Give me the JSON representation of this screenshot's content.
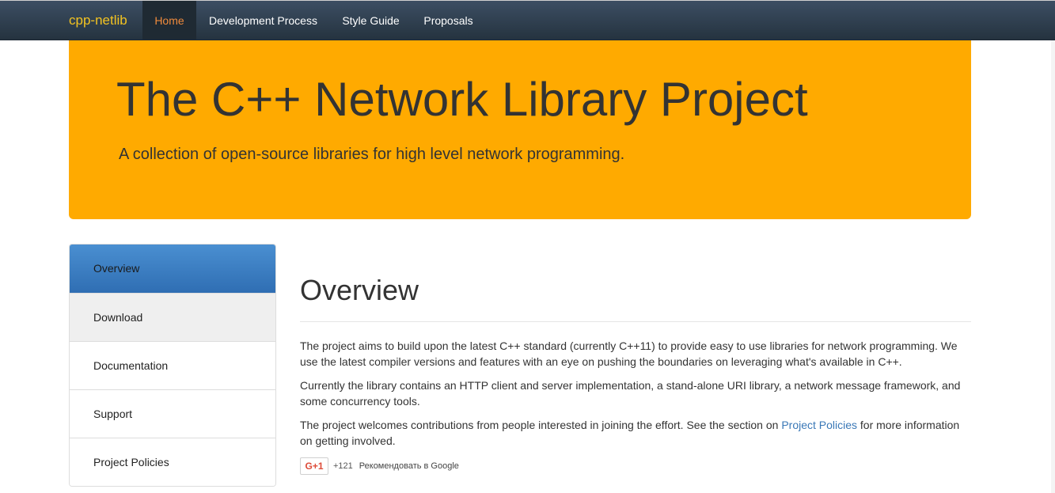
{
  "navbar": {
    "brand": "cpp-netlib",
    "items": [
      {
        "label": "Home",
        "active": true
      },
      {
        "label": "Development Process",
        "active": false
      },
      {
        "label": "Style Guide",
        "active": false
      },
      {
        "label": "Proposals",
        "active": false
      }
    ]
  },
  "jumbotron": {
    "title": "The C++ Network Library Project",
    "subtitle": "A collection of open-source libraries for high level network programming."
  },
  "sidebar": {
    "items": [
      {
        "label": "Overview",
        "active": true
      },
      {
        "label": "Download",
        "active": false
      },
      {
        "label": "Documentation",
        "active": false
      },
      {
        "label": "Support",
        "active": false
      },
      {
        "label": "Project Policies",
        "active": false
      }
    ]
  },
  "main": {
    "heading": "Overview",
    "paragraphs": [
      "The project aims to build upon the latest C++ standard (currently C++11) to provide easy to use libraries for network programming. We use the latest compiler versions and features with an eye on pushing the boundaries on leveraging what's available in C++.",
      "Currently the library contains an HTTP client and server implementation, a stand-alone URI library, a network message framework, and some concurrency tools."
    ],
    "p3_before": "The project welcomes contributions from people interested in joining the effort. See the section on ",
    "p3_link": "Project Policies",
    "p3_after": " for more information on getting involved."
  },
  "gplus": {
    "button_label": "G+1",
    "count": "+121",
    "label": "Рекомендовать в Google"
  },
  "colors": {
    "accent": "#ffaa00",
    "brand": "#f3c321",
    "active_nav": "#f08b3c",
    "sidebar_active": "#337ab7",
    "link": "#3a78b7"
  }
}
